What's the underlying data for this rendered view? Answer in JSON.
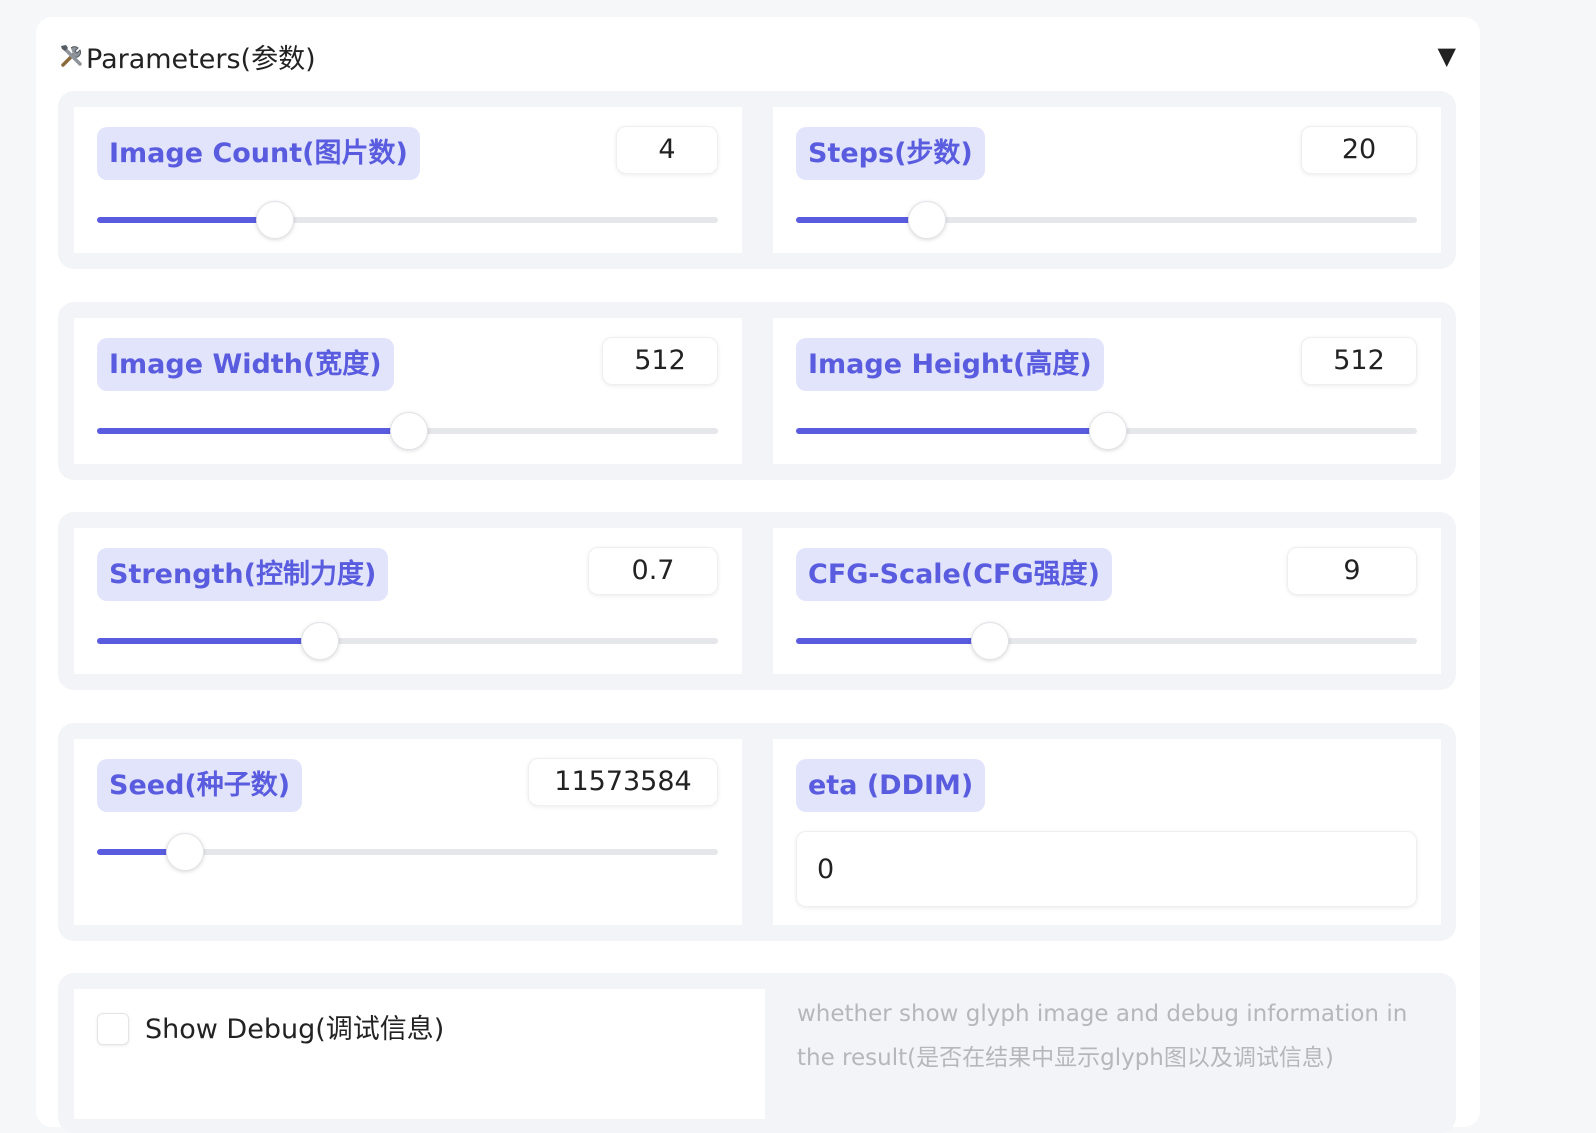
{
  "panel": {
    "title": "Parameters(参数)",
    "icons": {
      "title": "tools-icon",
      "collapse": "triangle-down-icon"
    },
    "collapse_glyph": "▼"
  },
  "colors": {
    "accent": "#5a5ce0",
    "label_bg": "#e2e4fb",
    "track": "#e6e7eb"
  },
  "params": {
    "image_count": {
      "label": "Image Count(图片数)",
      "value": "4",
      "fraction": 0.285
    },
    "steps": {
      "label": "Steps(步数)",
      "value": "20",
      "fraction": 0.21
    },
    "image_width": {
      "label": "Image Width(宽度)",
      "value": "512",
      "fraction": 0.5
    },
    "image_height": {
      "label": "Image Height(高度)",
      "value": "512",
      "fraction": 0.5
    },
    "strength": {
      "label": "Strength(控制力度)",
      "value": "0.7",
      "fraction": 0.358
    },
    "cfg_scale": {
      "label": "CFG-Scale(CFG强度)",
      "value": "9",
      "fraction": 0.31
    },
    "seed": {
      "label": "Seed(种子数)",
      "value": "11573584",
      "fraction": 0.14
    },
    "eta": {
      "label": "eta (DDIM)",
      "value": "0"
    }
  },
  "debug": {
    "label": "Show Debug(调试信息)",
    "checked": false,
    "info": "whether show glyph image and debug information in the result(是否在结果中显示glyph图以及调试信息)"
  }
}
